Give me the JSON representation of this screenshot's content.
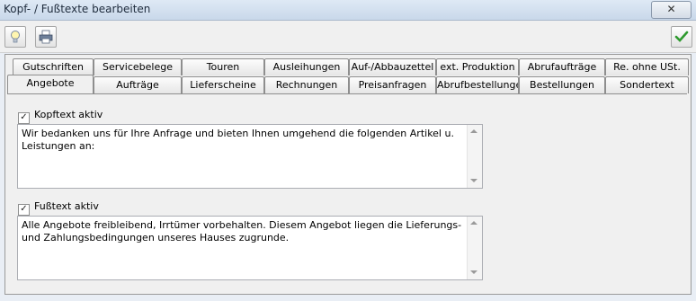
{
  "window": {
    "title": "Kopf- / Fußtexte bearbeiten",
    "close_icon": "✕"
  },
  "toolbar": {
    "hint_icon": "lightbulb-icon",
    "print_icon": "printer-icon",
    "ok_icon": "checkmark-icon"
  },
  "tabs_row1": [
    "Gutschriften",
    "Servicebelege",
    "Touren",
    "Ausleihungen",
    "Auf-/Abbauzettel",
    "ext. Produktion",
    "Abrufaufträge",
    "Re. ohne USt."
  ],
  "tabs_row2": [
    "Angebote",
    "Aufträge",
    "Lieferscheine",
    "Rechnungen",
    "Preisanfragen",
    "Abrufbestellungen",
    "Bestellungen",
    "Sondertext"
  ],
  "active_tab": "Angebote",
  "header": {
    "label": "Kopftext aktiv",
    "checked": true,
    "text": "Wir bedanken uns für Ihre Anfrage und bieten Ihnen umgehend die folgenden Artikel u. Leistungen an:"
  },
  "footer": {
    "label": "Fußtext aktiv",
    "checked": true,
    "text": "Alle Angebote freibleibend, Irrtümer vorbehalten. Diesem Angebot liegen die Lieferungs- und Zahlungsbedingungen unseres Hauses zugrunde."
  },
  "check_mark": "✓"
}
